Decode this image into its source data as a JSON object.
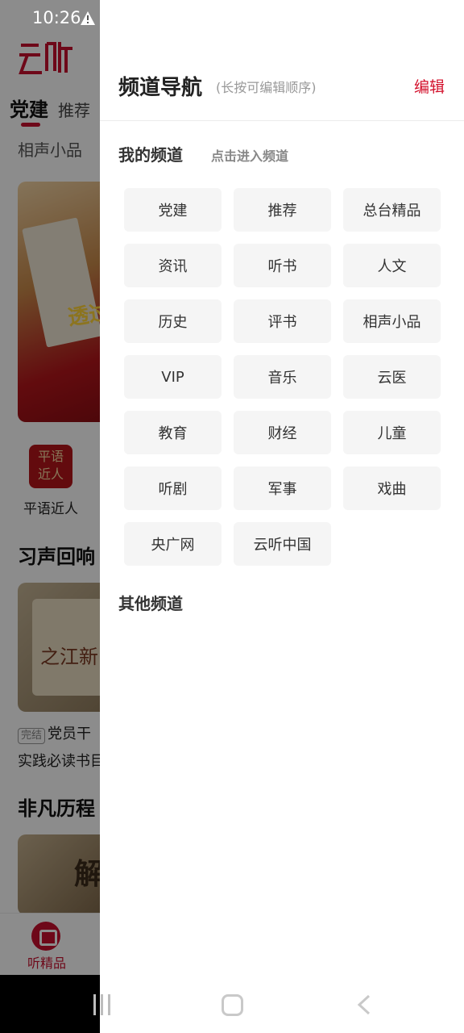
{
  "status_bar": {
    "time": "10:26",
    "alert_icon": "warning-triangle-icon"
  },
  "background_app": {
    "logo_text": "云听",
    "tabs": [
      "党建",
      "推荐"
    ],
    "subcategory": "相声小品",
    "banner_text": "透过",
    "shortcut": {
      "icon_text": "平语近人",
      "label": "平语近人"
    },
    "sections": [
      {
        "title": "习声回响",
        "album_text": "之江新",
        "badge": "完结",
        "item_line1": "党员干",
        "item_line2": "实践必读书目"
      },
      {
        "title": "非凡历程",
        "album_text": "解"
      }
    ],
    "bottom_nav": {
      "label": "听精品",
      "icon": "home-icon"
    }
  },
  "drawer": {
    "title": "频道导航",
    "hint": "(长按可编辑顺序)",
    "edit_label": "编辑",
    "my_channels_title": "我的频道",
    "my_channels_hint": "点击进入频道",
    "my_channels": [
      "党建",
      "推荐",
      "总台精品",
      "资讯",
      "听书",
      "人文",
      "历史",
      "评书",
      "相声小品",
      "VIP",
      "音乐",
      "云医",
      "教育",
      "财经",
      "儿童",
      "听剧",
      "军事",
      "戏曲",
      "央广网",
      "云听中国"
    ],
    "other_channels_title": "其他频道"
  },
  "system_nav": {
    "recent": "recent-apps-icon",
    "home": "home-button-icon",
    "back": "back-icon"
  },
  "colors": {
    "accent": "#d3112c",
    "chip_bg": "#f5f5f5"
  }
}
